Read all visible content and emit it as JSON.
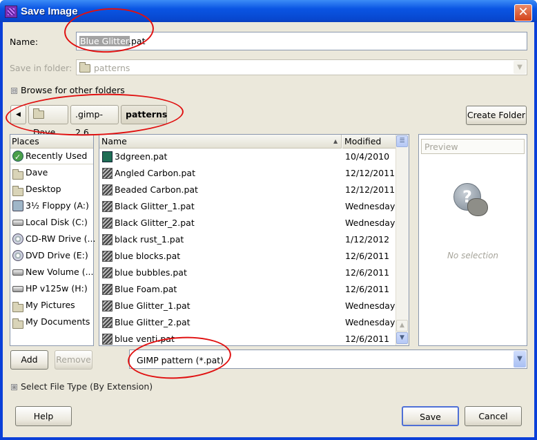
{
  "window": {
    "title": "Save Image",
    "close_glyph": "✕"
  },
  "name_field": {
    "label": "Name:",
    "value_selected": "Blue Glitter",
    "value_rest": ".pat"
  },
  "save_in_folder": {
    "label": "Save in folder:",
    "value": "patterns"
  },
  "browse_toggle": {
    "glyph": "⊟",
    "label": "Browse for other folders"
  },
  "path_bar": {
    "back_glyph": "◀",
    "segments": [
      "Dave",
      ".gimp-2.6",
      "patterns"
    ]
  },
  "create_folder_label": "Create Folder",
  "places": {
    "header": "Places",
    "items": [
      {
        "label": "Recently Used",
        "icon": "recent-icon"
      },
      {
        "label": "Dave",
        "icon": "folder-icon"
      },
      {
        "label": "Desktop",
        "icon": "folder-icon"
      },
      {
        "label": "3½ Floppy (A:)",
        "icon": "floppy-icon"
      },
      {
        "label": "Local Disk (C:)",
        "icon": "drive-icon"
      },
      {
        "label": "CD-RW Drive (...",
        "icon": "disc-icon"
      },
      {
        "label": "DVD Drive (E:)",
        "icon": "disc-icon"
      },
      {
        "label": "New Volume (...",
        "icon": "drive-icon"
      },
      {
        "label": "HP v125w (H:)",
        "icon": "drive-icon"
      },
      {
        "label": "My Pictures",
        "icon": "folder-icon"
      },
      {
        "label": "My Documents",
        "icon": "folder-icon"
      }
    ]
  },
  "files": {
    "col_name": "Name",
    "col_modified": "Modified",
    "sort_glyph": "▲",
    "rows": [
      {
        "name": "3dgreen.pat",
        "modified": "10/4/2010",
        "icon": "green-pattern-icon"
      },
      {
        "name": "Angled Carbon.pat",
        "modified": "12/12/2011",
        "icon": "pattern-file-icon"
      },
      {
        "name": "Beaded Carbon.pat",
        "modified": "12/12/2011",
        "icon": "pattern-file-icon"
      },
      {
        "name": "Black Glitter_1.pat",
        "modified": "Wednesday",
        "icon": "pattern-file-icon"
      },
      {
        "name": "Black Glitter_2.pat",
        "modified": "Wednesday",
        "icon": "pattern-file-icon"
      },
      {
        "name": "black rust_1.pat",
        "modified": "1/12/2012",
        "icon": "pattern-file-icon"
      },
      {
        "name": "blue blocks.pat",
        "modified": "12/6/2011",
        "icon": "pattern-file-icon"
      },
      {
        "name": "blue bubbles.pat",
        "modified": "12/6/2011",
        "icon": "pattern-file-icon"
      },
      {
        "name": "Blue Foam.pat",
        "modified": "12/6/2011",
        "icon": "pattern-file-icon"
      },
      {
        "name": "Blue Glitter_1.pat",
        "modified": "Wednesday",
        "icon": "pattern-file-icon"
      },
      {
        "name": "Blue Glitter_2.pat",
        "modified": "Wednesday",
        "icon": "pattern-file-icon"
      },
      {
        "name": "blue venti.pat",
        "modified": "12/6/2011",
        "icon": "pattern-file-icon"
      }
    ]
  },
  "preview": {
    "header": "Preview",
    "empty_text": "No selection"
  },
  "add_label": "Add",
  "remove_label": "Remove",
  "file_type": {
    "value": "GIMP pattern (*.pat)"
  },
  "select_file_type": {
    "glyph": "⊞",
    "label": "Select File Type (By Extension)"
  },
  "footer": {
    "help": "Help",
    "save": "Save",
    "cancel": "Cancel"
  },
  "colors": {
    "title_blue": "#0a55e3",
    "dialog_bg": "#ebe8db",
    "annotation_red": "#e01010"
  }
}
